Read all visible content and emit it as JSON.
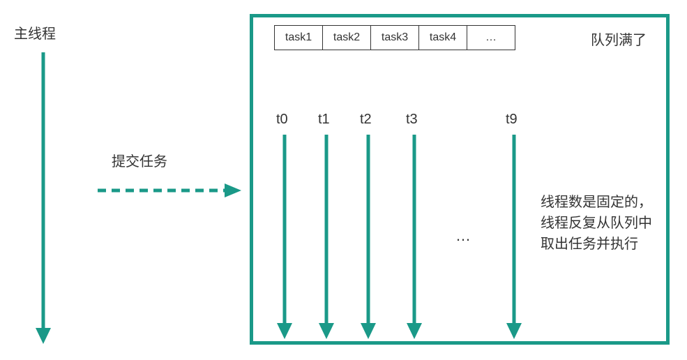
{
  "main_thread_label": "主线程",
  "submit_label": "提交任务",
  "queue": {
    "cells": [
      "task1",
      "task2",
      "task3",
      "task4",
      "…"
    ],
    "full_label": "队列满了"
  },
  "threads": {
    "labels": [
      "t0",
      "t1",
      "t2",
      "t3",
      "t9"
    ],
    "ellipsis": "…"
  },
  "description": "线程数是固定的，线程反复从队列中取出任务并执行",
  "colors": {
    "accent": "#1a9988"
  }
}
